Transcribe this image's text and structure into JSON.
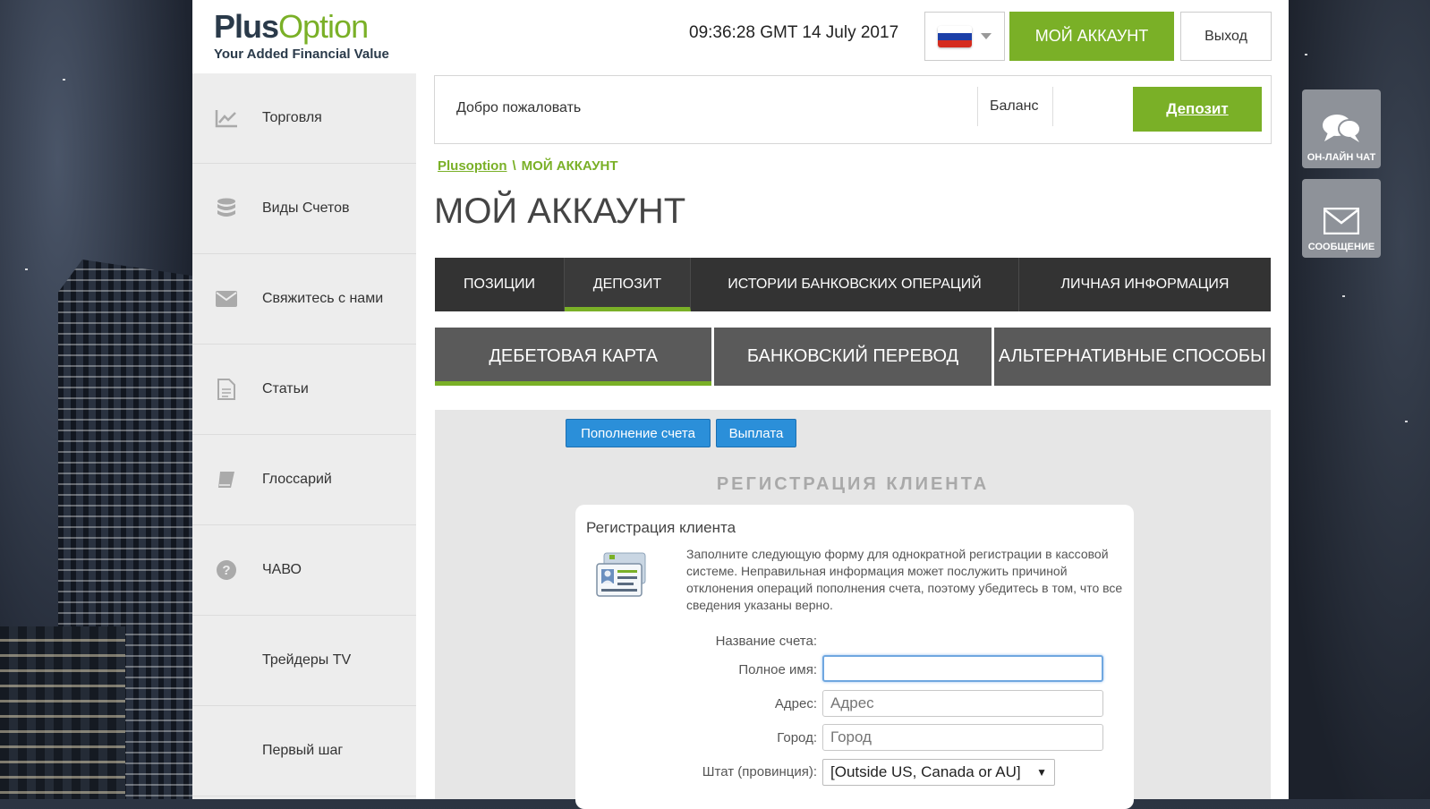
{
  "logo": {
    "brand_part1": "Plus",
    "brand_part2": "Option",
    "tagline": "Your Added Financial Value"
  },
  "header": {
    "clock": "09:36:28 GMT 14 July 2017",
    "language_flag": "russia-flag-icon",
    "account_button": "МОЙ АККАУНТ",
    "exit_button": "Выход"
  },
  "welcome_bar": {
    "welcome": "Добро пожаловать",
    "balance_label": "Баланс",
    "deposit_button": "Депозит"
  },
  "breadcrumb": {
    "home": "Plusoption",
    "separator": "\\",
    "current": "МОЙ АККАУНТ"
  },
  "page_title": "МОЙ АККАУНТ",
  "sidebar": {
    "items": [
      {
        "label": "Торговля",
        "icon": "chart-line-icon"
      },
      {
        "label": "Виды Счетов",
        "icon": "database-icon"
      },
      {
        "label": "Свяжитесь с нами",
        "icon": "envelope-icon"
      },
      {
        "label": "Статьи",
        "icon": "document-icon"
      },
      {
        "label": "Глоссарий",
        "icon": "book-icon"
      },
      {
        "label": "ЧАВО",
        "icon": "question-icon"
      },
      {
        "label": "Трейдеры TV",
        "icon": ""
      },
      {
        "label": "Первый шаг",
        "icon": ""
      }
    ]
  },
  "tabs": [
    {
      "label": "ПОЗИЦИИ",
      "active": false
    },
    {
      "label": "ДЕПОЗИТ",
      "active": true
    },
    {
      "label": "ИСТОРИИ БАНКОВСКИХ ОПЕРАЦИЙ",
      "active": false
    },
    {
      "label": "ЛИЧНАЯ ИНФОРМАЦИЯ",
      "active": false
    }
  ],
  "subtabs": [
    {
      "label": "ДЕБЕТОВАЯ КАРТА",
      "active": true
    },
    {
      "label": "БАНКОВСКИЙ ПЕРЕВОД",
      "active": false
    },
    {
      "label": "АЛЬТЕРНАТИВНЫЕ СПОСОБЫ",
      "active": false
    }
  ],
  "actions": {
    "topup": "Пополнение счета",
    "payout": "Выплата"
  },
  "registration": {
    "heading": "РЕГИСТРАЦИЯ КЛИЕНТА",
    "card_title": "Регистрация клиента",
    "description": "Заполните следующую форму для однократной регистрации в кассовой системе. Неправильная информация может послужить причиной отклонения операций пополнения счета, поэтому убедитесь в том, что все сведения указаны верно.",
    "fields": {
      "account_name_label": "Название счета:",
      "full_name_label": "Полное имя:",
      "full_name_value": "",
      "address_label": "Адрес:",
      "address_placeholder": "Адрес",
      "city_label": "Город:",
      "city_placeholder": "Город",
      "state_label": "Штат (провинция):",
      "state_value": "[Outside US, Canada or AU]"
    }
  },
  "floating": {
    "chat": "ОН-ЛАЙН ЧАТ",
    "message": "СООБЩЕНИЕ"
  },
  "colors": {
    "accent_green": "#7ab027",
    "dark_tab": "#333333",
    "blue_button": "#2b8fd9"
  }
}
